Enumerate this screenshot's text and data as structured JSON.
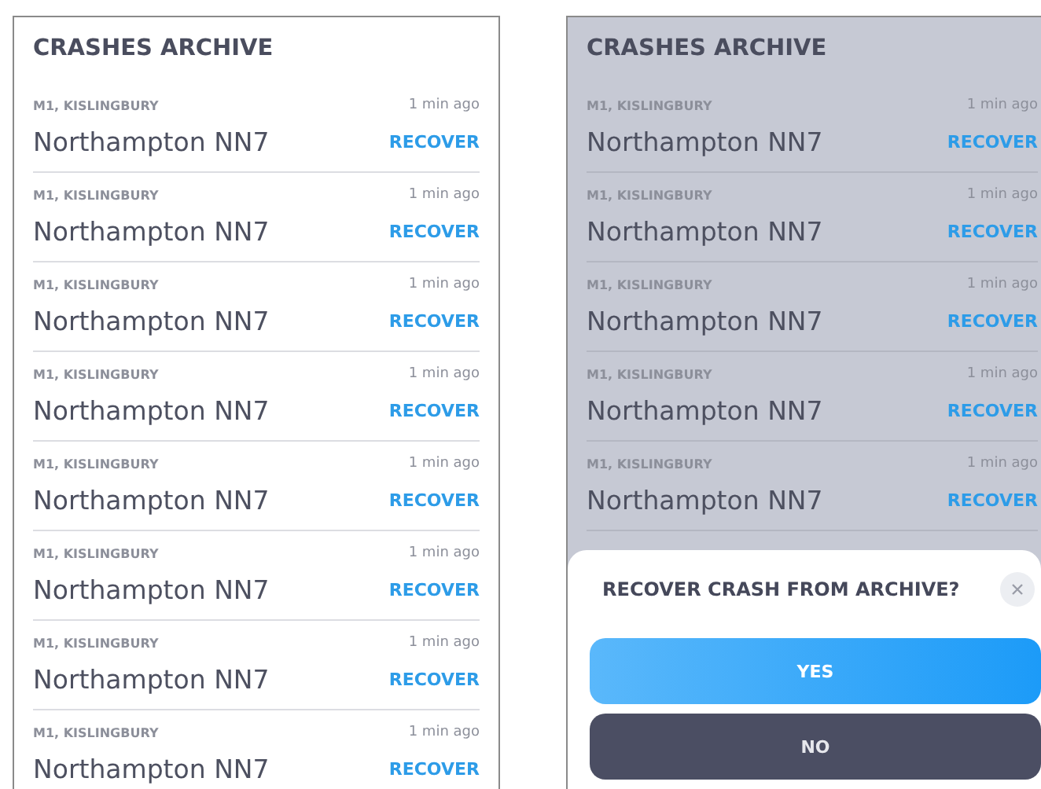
{
  "panels": [
    {
      "title": "CRASHES ARCHIVE",
      "dimmed": false,
      "rows": [
        {
          "place": "M1, KISLINGBURY",
          "name": "Northampton NN7",
          "time": "1 min ago",
          "action": "RECOVER"
        },
        {
          "place": "M1, KISLINGBURY",
          "name": "Northampton NN7",
          "time": "1 min ago",
          "action": "RECOVER"
        },
        {
          "place": "M1, KISLINGBURY",
          "name": "Northampton NN7",
          "time": "1 min ago",
          "action": "RECOVER"
        },
        {
          "place": "M1, KISLINGBURY",
          "name": "Northampton NN7",
          "time": "1 min ago",
          "action": "RECOVER"
        },
        {
          "place": "M1, KISLINGBURY",
          "name": "Northampton NN7",
          "time": "1 min ago",
          "action": "RECOVER"
        },
        {
          "place": "M1, KISLINGBURY",
          "name": "Northampton NN7",
          "time": "1 min ago",
          "action": "RECOVER"
        },
        {
          "place": "M1, KISLINGBURY",
          "name": "Northampton NN7",
          "time": "1 min ago",
          "action": "RECOVER"
        },
        {
          "place": "M1, KISLINGBURY",
          "name": "Northampton NN7",
          "time": "1 min ago",
          "action": "RECOVER"
        }
      ]
    },
    {
      "title": "CRASHES ARCHIVE",
      "dimmed": true,
      "rows": [
        {
          "place": "M1, KISLINGBURY",
          "name": "Northampton NN7",
          "time": "1 min ago",
          "action": "RECOVER"
        },
        {
          "place": "M1, KISLINGBURY",
          "name": "Northampton NN7",
          "time": "1 min ago",
          "action": "RECOVER"
        },
        {
          "place": "M1, KISLINGBURY",
          "name": "Northampton NN7",
          "time": "1 min ago",
          "action": "RECOVER"
        },
        {
          "place": "M1, KISLINGBURY",
          "name": "Northampton NN7",
          "time": "1 min ago",
          "action": "RECOVER"
        },
        {
          "place": "M1, KISLINGBURY",
          "name": "Northampton NN7",
          "time": "1 min ago",
          "action": "RECOVER"
        }
      ],
      "dialog": {
        "title": "RECOVER CRASH FROM ARCHIVE?",
        "buttons": [
          {
            "label": "YES",
            "kind": "primary"
          },
          {
            "label": "NO",
            "kind": "secondary"
          }
        ]
      }
    }
  ]
}
